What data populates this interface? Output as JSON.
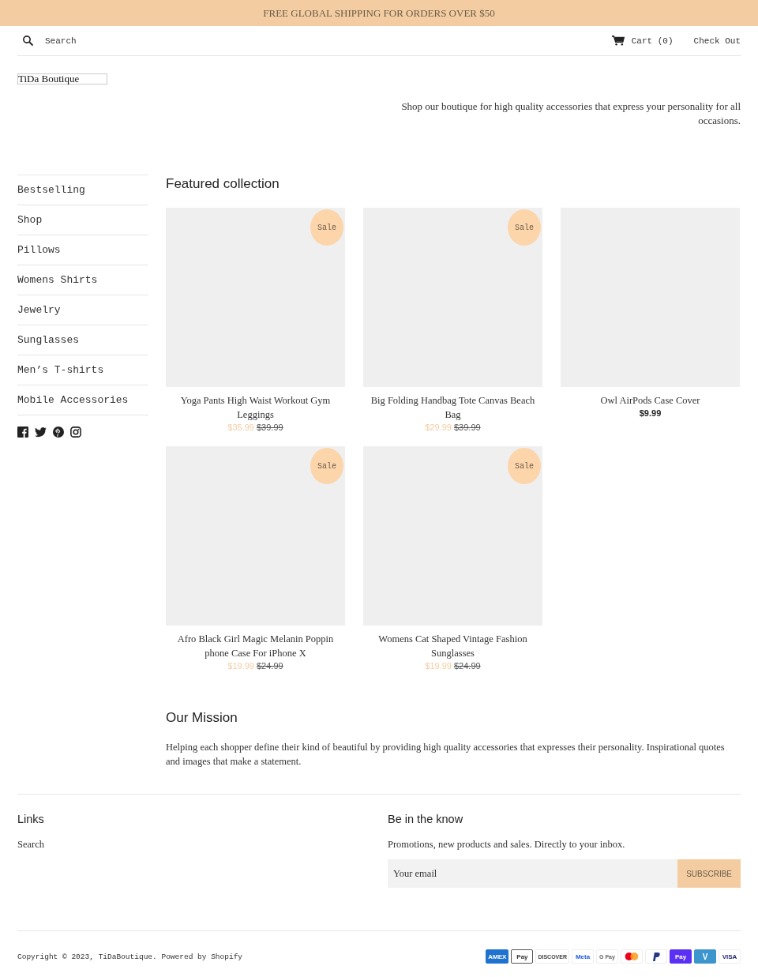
{
  "announcement": "FREE GLOBAL SHIPPING FOR ORDERS OVER $50",
  "header": {
    "search_placeholder": "Search",
    "cart": "Cart (0)",
    "checkout": "Check Out"
  },
  "logo": "TiDa Boutique",
  "tagline": "Shop our boutique for high quality accessories that express your personality for all occasions.",
  "sidebar": {
    "items": [
      "Bestselling",
      "Shop",
      "Pillows",
      "Womens Shirts",
      "Jewelry",
      "Sunglasses",
      "Men’s T-shirts",
      "Mobile Accessories"
    ]
  },
  "featured": {
    "title": "Featured collection",
    "products": [
      {
        "title": "Yoga Pants High Waist Workout Gym Leggings",
        "badge": "Sale",
        "price": "$35.99",
        "compare_price": "$39.99"
      },
      {
        "title": "Big Folding Handbag Tote Canvas Beach Bag",
        "badge": "Sale",
        "price": "$29.99",
        "compare_price": "$39.99"
      },
      {
        "title": "Owl AirPods Case Cover",
        "price": "$9.99"
      },
      {
        "title": "Afro Black Girl Magic Melanin Poppin phone Case For iPhone X",
        "badge": "Sale",
        "price": "$19.99",
        "compare_price": "$24.99"
      },
      {
        "title": "Womens Cat Shaped Vintage Fashion Sunglasses",
        "badge": "Sale",
        "price": "$19.99",
        "compare_price": "$24.99"
      }
    ]
  },
  "mission": {
    "title": "Our Mission",
    "text": "Helping each shopper define their kind of beautiful by providing high quality accessories that expresses their personality. Inspirational quotes and images that make a statement."
  },
  "footer": {
    "links_title": "Links",
    "links": [
      "Search"
    ],
    "newsletter_title": "Be in the know",
    "newsletter_text": "Promotions, new products and sales. Directly to your inbox.",
    "email_placeholder": "Your email",
    "subscribe": "SUBSCRIBE",
    "copyright": "Copyright © 2023, ",
    "store_link": "TiDaBoutique",
    "powered": ". Powered by Shopify",
    "payments": [
      {
        "kind": "amex",
        "label": "AMEX"
      },
      {
        "kind": "applepay",
        "label": "Pay"
      },
      {
        "kind": "discover",
        "label": "DISCOVER"
      },
      {
        "kind": "meta",
        "label": "Meta"
      },
      {
        "kind": "gpay",
        "label": "G Pay"
      },
      {
        "kind": "mastercard"
      },
      {
        "kind": "paypal"
      },
      {
        "kind": "shoppay",
        "label": "Pay"
      },
      {
        "kind": "venmo",
        "label": "V"
      },
      {
        "kind": "visa",
        "label": "VISA"
      }
    ]
  }
}
